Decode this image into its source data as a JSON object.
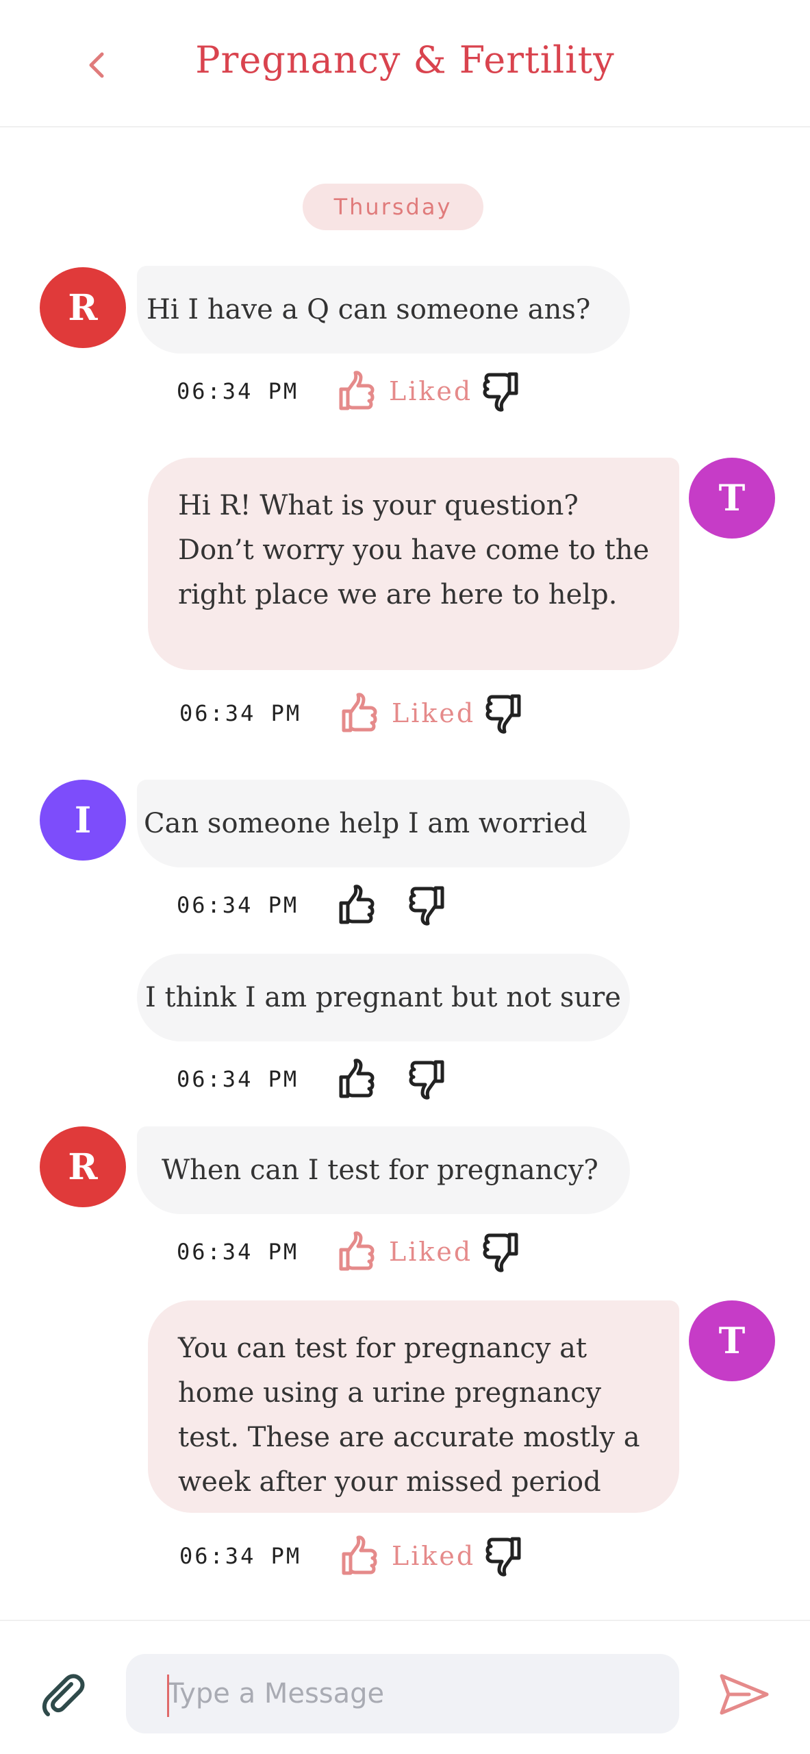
{
  "header": {
    "title": "Pregnancy & Fertility",
    "back_icon": "chevron-left-icon"
  },
  "day_separator": "Thursday",
  "messages": [
    {
      "sender": "R",
      "avatar_color": "#e03a3a",
      "text": "Hi I have a Q can someone ans?",
      "time": "06:34 PM",
      "liked": true,
      "liked_label": "Liked"
    },
    {
      "sender": "T",
      "avatar_color": "#c63cc7",
      "text": "Hi R! What is your question? Don’t worry you have come to the right place we are here to help.",
      "time": "06:34 PM",
      "liked": true,
      "liked_label": "Liked"
    },
    {
      "sender": "I",
      "avatar_color": "#7d4dfb",
      "text": "Can someone help I am worried",
      "time": "06:34 PM",
      "liked": false
    },
    {
      "sender": "I",
      "text": "I think I am pregnant but not sure",
      "time": "06:34 PM",
      "liked": false
    },
    {
      "sender": "R",
      "avatar_color": "#e03a3a",
      "text": "When can I test for pregnancy?",
      "time": "06:34 PM",
      "liked": true,
      "liked_label": "Liked"
    },
    {
      "sender": "T",
      "avatar_color": "#c63cc7",
      "text": "You can test for pregnancy at home using a urine pregnancy test. These are accurate mostly a week after your missed period",
      "time": "06:34 PM",
      "liked": true,
      "liked_label": "Liked"
    }
  ],
  "composer": {
    "placeholder": "Type a Message",
    "attach_icon": "paperclip-icon",
    "send_icon": "send-icon"
  },
  "colors": {
    "accent": "#d9434e",
    "liked": "#e58a8a",
    "incoming_bubble": "#f5f5f6",
    "outgoing_bubble": "#f8eaea"
  }
}
